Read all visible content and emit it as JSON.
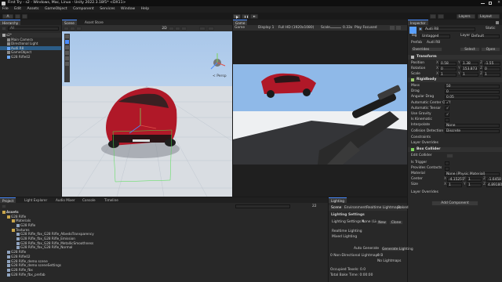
{
  "window": {
    "title": "First Try - s2 - Windows, Mac, Linux - Unity 2022.3.18f1* <DX11>"
  },
  "menu": [
    "File",
    "Edit",
    "Assets",
    "GameObject",
    "Component",
    "Services",
    "Window",
    "Help"
  ],
  "toolbar": {
    "account": "A",
    "layers": "Layers",
    "layout": "Layout"
  },
  "hierarchy": {
    "tab": "Hierarchy",
    "search": "All",
    "items": [
      "s2*",
      "Main Camera",
      "Directional Light",
      "Audi R8",
      "GameObject",
      "G28 Rifle02"
    ]
  },
  "scene": {
    "tabs": [
      "Scene",
      "Asset Store"
    ],
    "mode": "2D",
    "persp": "< Persp"
  },
  "game": {
    "tab": "Game",
    "view": "Game",
    "display": "Display 1",
    "resolution": "Full HD (1920x1080)",
    "scale_label": "Scale",
    "scale_value": "0.33x",
    "play_focused": "Play Focused"
  },
  "inspector": {
    "tab": "Inspector",
    "object_name": "Audi R8",
    "static_label": "Static",
    "tag_label": "Tag",
    "tag_value": "Untagged",
    "layer_label": "Layer",
    "layer_value": "Default",
    "prefab_label": "Prefab",
    "prefab_value": "Audi R8",
    "overrides": "Overrides",
    "select": "Select",
    "open": "Open",
    "transform": {
      "title": "Transform",
      "rows": [
        {
          "label": "Position",
          "x": "0.58",
          "y": "1.38",
          "z": "-1.55"
        },
        {
          "label": "Rotation",
          "x": "0",
          "y": "153.873",
          "z": "0"
        },
        {
          "label": "Scale",
          "x": "1",
          "y": "1",
          "z": "1"
        }
      ]
    },
    "rigidbody": {
      "title": "Rigidbody",
      "rows": [
        {
          "label": "Mass",
          "value": "50"
        },
        {
          "label": "Drag",
          "value": "0"
        },
        {
          "label": "Angular Drag",
          "value": "0.05"
        },
        {
          "label": "Automatic Center Of M",
          "value": "✓"
        },
        {
          "label": "Automatic Tensor",
          "value": "✓"
        },
        {
          "label": "Use Gravity",
          "value": "✓"
        },
        {
          "label": "Is Kinematic",
          "value": ""
        },
        {
          "label": "Interpolate",
          "value": "None"
        },
        {
          "label": "Collision Detection",
          "value": "Discrete"
        }
      ],
      "constraints": "Constraints",
      "layer_overrides": "Layer Overrides"
    },
    "box_collider": {
      "title": "Box Collider",
      "edit_collider": "Edit Collider",
      "rows": [
        {
          "label": "Is Trigger",
          "value": ""
        },
        {
          "label": "Provides Contacts",
          "value": ""
        },
        {
          "label": "Material",
          "value": "None (Physic Material)"
        }
      ],
      "center": {
        "label": "Center",
        "x": "-4.15251",
        "y": "1",
        "z": "-1.6458"
      },
      "size": {
        "label": "Size",
        "x": "1",
        "y": "1",
        "z": "4.89180"
      },
      "layer_overrides": "Layer Overrides"
    },
    "add_component": "Add Component"
  },
  "project": {
    "tabs": [
      "Project",
      "Light Explorer",
      "Audio Mixer",
      "Console",
      "Timeline"
    ],
    "root": "Assets",
    "items": [
      "G28 Rifle",
      "Materials",
      "G28 Rifle",
      "Textures",
      "G28 Rifle_fbx_G28 Rifle_AlbedoTransparency",
      "G28 Rifle_fbx_G28 Rifle_Emission",
      "G28 Rifle_fbx_G28 Rifle_MetallicSmoothness",
      "G28 Rifle_fbx_G28 Rifle_Normal",
      "G28 Rifle",
      "G28 Rifle02",
      "G28 Rifle_demo scene",
      "G28 Rifle_demo sceneSettings",
      "G28 Rifle_fbx",
      "G28 Rifle_fbx_prefab"
    ],
    "count": "22"
  },
  "lighting": {
    "tab": "Lighting",
    "subtabs": [
      "Scene",
      "Environment",
      "Realtime Lightmaps",
      "Baked"
    ],
    "settings_title": "Lighting Settings",
    "settings_label": "Lighting Settings A",
    "settings_value": "None (Lig",
    "new": "New",
    "clone": "Clone",
    "realtime": "Realtime Lighting",
    "mixed": "Mixed Lighting",
    "auto_generate": "Auto Generate",
    "generate": "Generate Lighting",
    "stats": [
      "0 Non-Directional Lightmaps",
      "Occupied Texels: 0.0",
      "Total Bake Time: 0:00:00"
    ],
    "stat_value": "0 B",
    "no_lightmaps": "No Lightmaps"
  },
  "colors": {
    "accent": "#4a8cff",
    "selection": "#2c5d87",
    "car": "#b01828",
    "sky": "#8fb9e8"
  }
}
